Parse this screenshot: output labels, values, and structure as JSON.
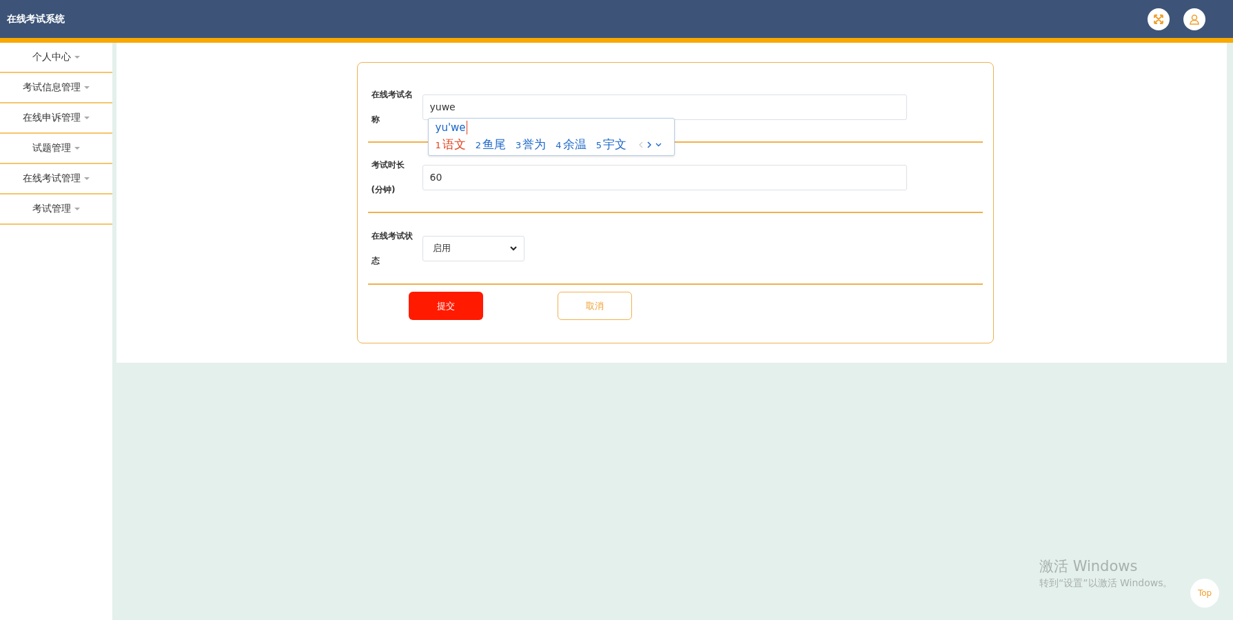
{
  "header": {
    "title": "在线考试系统"
  },
  "sidebar": {
    "items": [
      {
        "label": "个人中心"
      },
      {
        "label": "考试信息管理"
      },
      {
        "label": "在线申诉管理"
      },
      {
        "label": "试题管理"
      },
      {
        "label": "在线考试管理"
      },
      {
        "label": "考试管理"
      }
    ]
  },
  "form": {
    "fields": [
      {
        "kind": "text",
        "label": "在线考试名称",
        "value": "yuwe"
      },
      {
        "kind": "text",
        "label": "考试时长(分钟)",
        "value": "60"
      },
      {
        "kind": "select",
        "label": "在线考试状态",
        "value": "启用"
      }
    ],
    "buttons": [
      {
        "kind": "primary",
        "label": "提交"
      },
      {
        "kind": "secondary",
        "label": "取消"
      }
    ]
  },
  "ime_popup": {
    "composition": "yu'we",
    "candidates": [
      {
        "index": "1",
        "text": "语文",
        "selected": true
      },
      {
        "index": "2",
        "text": "鱼尾",
        "selected": false
      },
      {
        "index": "3",
        "text": "誉为",
        "selected": false
      },
      {
        "index": "4",
        "text": "余温",
        "selected": false
      },
      {
        "index": "5",
        "text": "宇文",
        "selected": false
      }
    ]
  },
  "back_to_top": "Top",
  "os_notice": {
    "title": "激活 Windows",
    "text": "转到“设置”以激活 Windows。"
  }
}
